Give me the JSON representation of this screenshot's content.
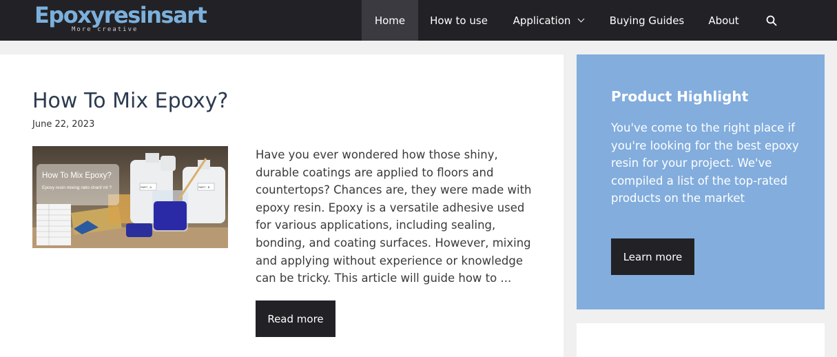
{
  "site": {
    "logo_text": "Epoxyresinsart",
    "tagline": "More creative"
  },
  "nav": {
    "items": [
      {
        "label": "Home",
        "active": true
      },
      {
        "label": "How to use"
      },
      {
        "label": "Application",
        "has_dropdown": true
      },
      {
        "label": "Buying Guides"
      },
      {
        "label": "About"
      }
    ],
    "search_icon": "search-icon"
  },
  "article": {
    "title": "How To Mix Epoxy?",
    "date": "June 22, 2023",
    "thumbnail": {
      "overlay_title": "How To Mix Epoxy?",
      "overlay_subtitle": "Epoxy resin mixing ratio chart/ ml ?",
      "bottle_label_a": "PART - A",
      "bottle_label_b": "PART - B"
    },
    "excerpt": "Have you ever wondered how those shiny, durable coatings are applied to floors and countertops? Chances are, they were made with epoxy resin. Epoxy is a versatile adhesive used for various applications, including sealing, bonding, and coating surfaces. However, mixing and applying without experience or knowledge can be tricky. This article will guide how to ...",
    "read_more_label": "Read more"
  },
  "sidebar": {
    "highlight": {
      "title": "Product Highlight",
      "text": "You've come to the right place if you're looking for the best epoxy resin for your project. We've compiled a list of the top-rated products on the market",
      "button_label": "Learn more"
    }
  },
  "colors": {
    "header_bg": "#222226",
    "logo": "#7cb0dc",
    "title": "#2b3a4e",
    "highlight_bg": "#82addd",
    "button_bg": "#222226"
  }
}
